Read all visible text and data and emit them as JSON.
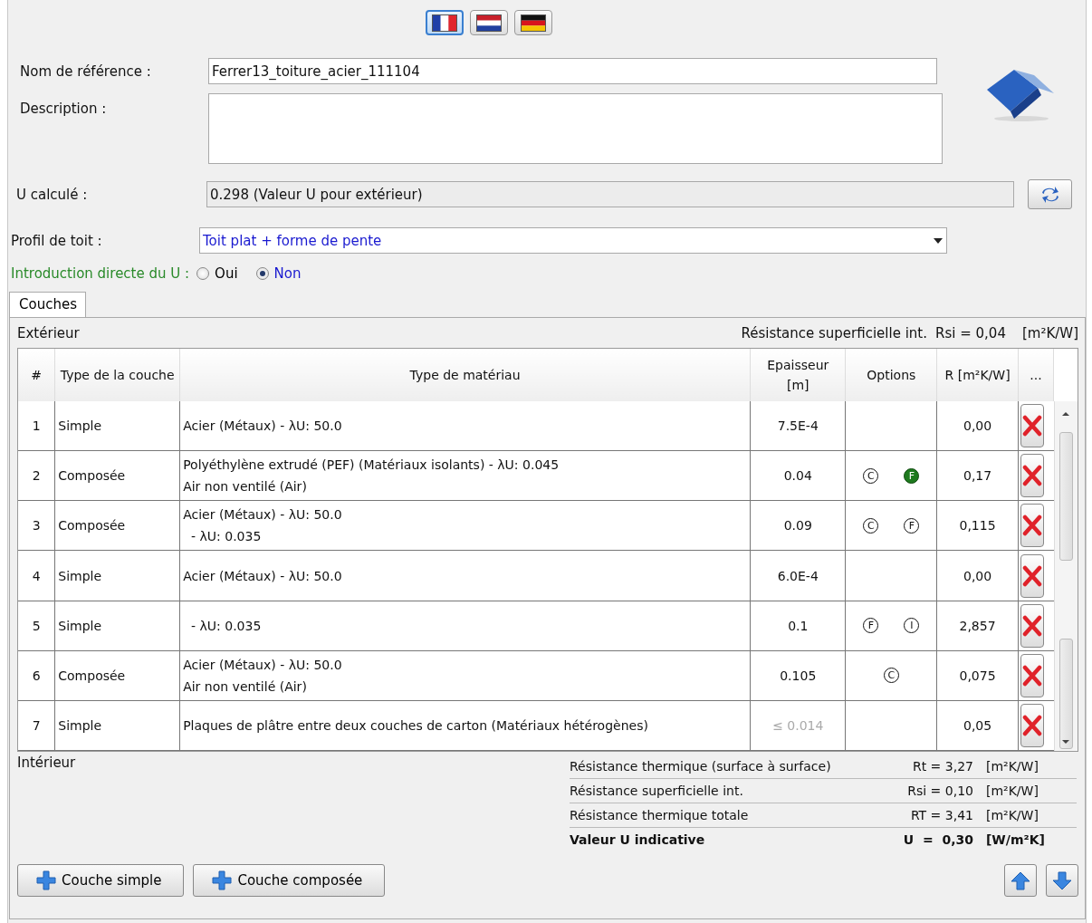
{
  "languages": [
    {
      "kind": "fr",
      "selected": true
    },
    {
      "kind": "nl",
      "selected": false
    },
    {
      "kind": "de",
      "selected": false
    }
  ],
  "form": {
    "reference_label": "Nom de référence :",
    "reference_value": "Ferrer13_toiture_acier_111104",
    "description_label": "Description :",
    "u_label": "U calculé :",
    "u_value": "0.298 (Valeur U pour extérieur)",
    "profile_label": "Profil de toit :",
    "profile_value": "Toit plat + forme de pente",
    "direct_label": "Introduction directe du U :",
    "direct_options": [
      {
        "label": "Oui",
        "selected": false
      },
      {
        "label": "Non",
        "selected": true
      }
    ]
  },
  "tabs": [
    {
      "label": "Couches",
      "selected": true
    }
  ],
  "panel": {
    "top_left": "Extérieur",
    "top_label": "Résistance superficielle int.",
    "top_value": "Rsi = 0,04",
    "top_unit": "[m²K/W]",
    "bottom_left": "Intérieur"
  },
  "table": {
    "columns": [
      "#",
      "Type de la couche",
      "Type de matériau",
      "Epaisseur [m]",
      "Options",
      "R [m²K/W]",
      "..."
    ],
    "rows": [
      {
        "n": "1",
        "type": "Simple",
        "material": [
          "Acier (Métaux) - λU: 50.0"
        ],
        "thickness": "7.5E-4",
        "disabled": false,
        "options": [],
        "r": "0,00"
      },
      {
        "n": "2",
        "type": "Composée",
        "material": [
          "Polyéthylène extrudé (PEF) (Matériaux isolants) - λU: 0.045",
          "Air non ventilé (Air)"
        ],
        "thickness": "0.04",
        "disabled": false,
        "options": [
          {
            "letter": "C",
            "filled": false
          },
          {
            "letter": "F",
            "filled": true
          }
        ],
        "r": "0,17"
      },
      {
        "n": "3",
        "type": "Composée",
        "material": [
          "Acier (Métaux) - λU: 50.0",
          "  - λU: 0.035"
        ],
        "thickness": "0.09",
        "disabled": false,
        "options": [
          {
            "letter": "C",
            "filled": false
          },
          {
            "letter": "F",
            "filled": false
          }
        ],
        "r": "0,115"
      },
      {
        "n": "4",
        "type": "Simple",
        "material": [
          "Acier (Métaux) - λU: 50.0"
        ],
        "thickness": "6.0E-4",
        "disabled": false,
        "options": [],
        "r": "0,00"
      },
      {
        "n": "5",
        "type": "Simple",
        "material": [
          "  - λU: 0.035"
        ],
        "thickness": "0.1",
        "disabled": false,
        "options": [
          {
            "letter": "F",
            "filled": false
          },
          {
            "letter": "I",
            "filled": false
          }
        ],
        "r": "2,857"
      },
      {
        "n": "6",
        "type": "Composée",
        "material": [
          "Acier (Métaux) - λU: 50.0",
          "Air non ventilé (Air)"
        ],
        "thickness": "0.105",
        "disabled": false,
        "options": [
          {
            "letter": "C",
            "filled": false
          }
        ],
        "r": "0,075"
      },
      {
        "n": "7",
        "type": "Simple",
        "material": [
          "Plaques de plâtre entre deux couches de carton (Matériaux hétérogènes)"
        ],
        "thickness": "≤ 0.014",
        "disabled": true,
        "options": [],
        "r": "0,05"
      }
    ]
  },
  "summary": [
    {
      "label": "Résistance thermique (surface à surface)",
      "value": "Rt = 3,27",
      "unit": "[m²K/W]",
      "bold": false
    },
    {
      "label": "Résistance superficielle int.",
      "value": "Rsi = 0,10",
      "unit": "[m²K/W]",
      "bold": false
    },
    {
      "label": "Résistance thermique totale",
      "value": "RT = 3,41",
      "unit": "[m²K/W]",
      "bold": false
    },
    {
      "label": "Valeur U indicative",
      "value": "U  =  0,30",
      "unit": "[W/m²K]",
      "bold": true
    }
  ],
  "buttons": [
    "Couche simple",
    "Couche composée"
  ]
}
